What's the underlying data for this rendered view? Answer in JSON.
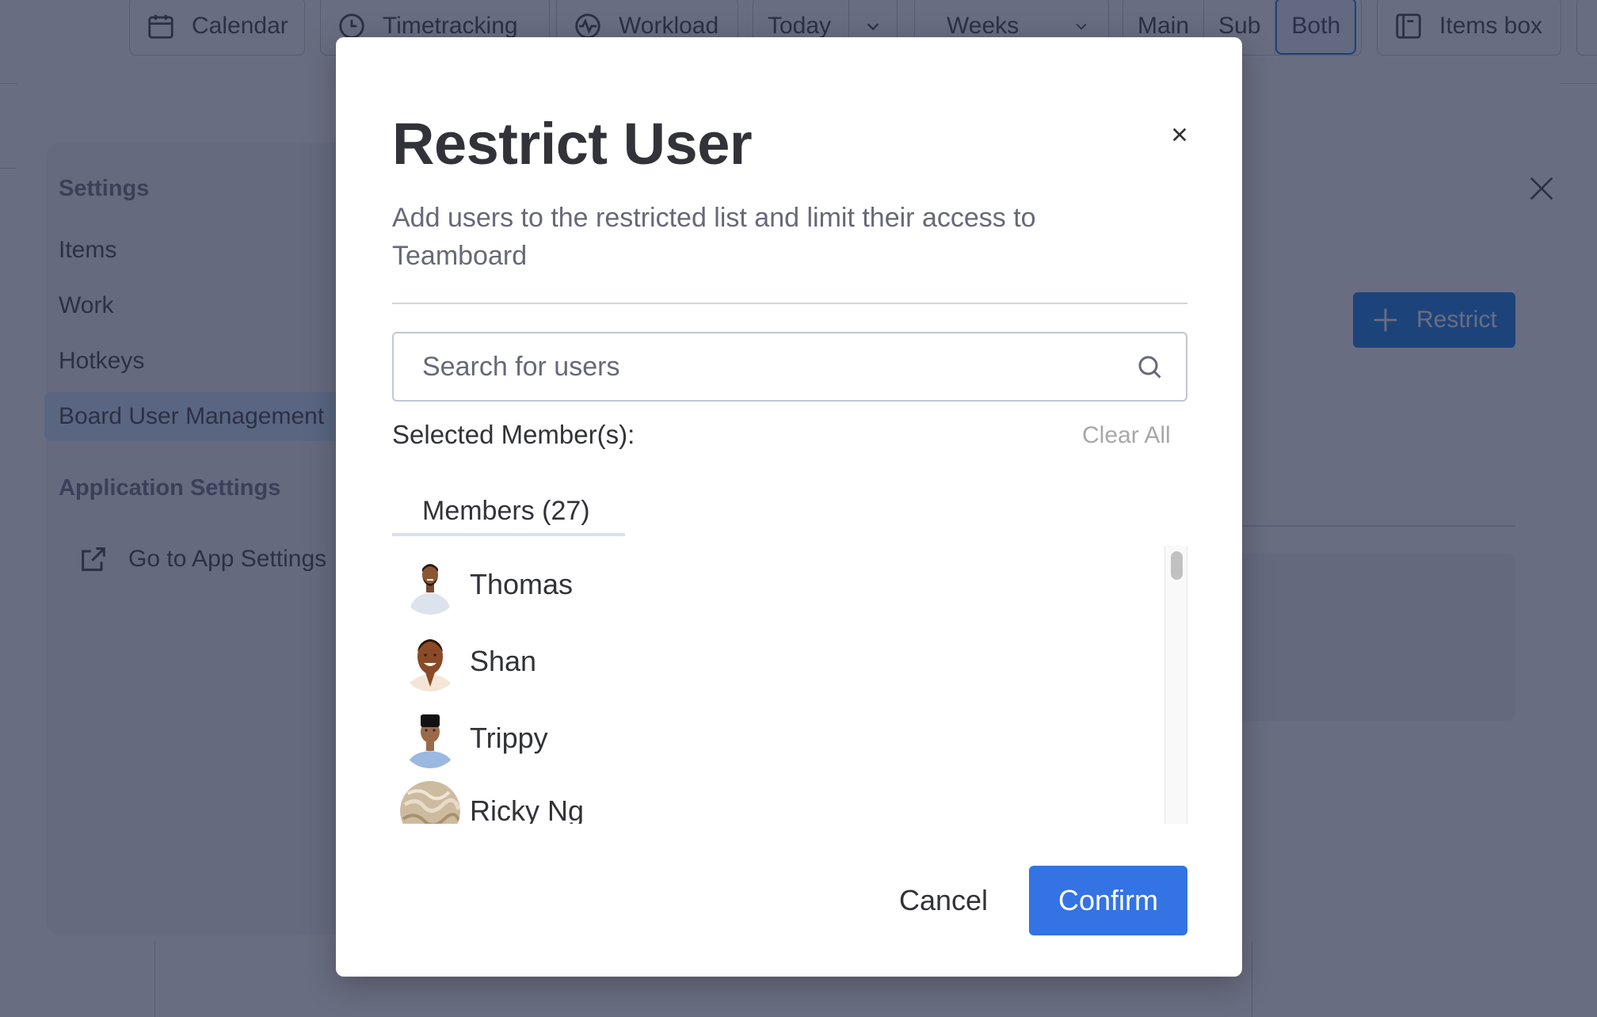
{
  "toolbar": {
    "calendar_label": "Calendar",
    "timetracking_label": "Timetracking",
    "workload_label": "Workload",
    "today_label": "Today",
    "weeks_label": "Weeks",
    "view_segments": [
      "Main",
      "Sub",
      "Both"
    ],
    "active_segment": "Both",
    "items_box_label": "Items box"
  },
  "settings_panel": {
    "settings_heading": "Settings",
    "nav_items": [
      {
        "label": "Items",
        "active": false
      },
      {
        "label": "Work",
        "active": false
      },
      {
        "label": "Hotkeys",
        "active": false
      },
      {
        "label": "Board User Management",
        "active": true
      }
    ],
    "app_settings_heading": "Application Settings",
    "go_to_app_settings_label": "Go to App Settings",
    "restrict_button_label": "Restrict"
  },
  "modal": {
    "title": "Restrict User",
    "description": "Add users to the restricted list and limit their access to Teamboard",
    "search": {
      "value": "",
      "placeholder": "Search for users"
    },
    "selected_members_label": "Selected Member(s):",
    "clear_all_label": "Clear All",
    "members_tab_label": "Members (27)",
    "members": [
      {
        "name": "Thomas",
        "avatar": "avatar-thomas"
      },
      {
        "name": "Shan",
        "avatar": "avatar-shan"
      },
      {
        "name": "Trippy",
        "avatar": "avatar-trippy"
      },
      {
        "name": "Ricky Ng",
        "avatar": "avatar-ricky-ng"
      }
    ],
    "cancel_label": "Cancel",
    "confirm_label": "Confirm"
  },
  "colors": {
    "primary": "#3373e4",
    "overlay": "#292f4c",
    "text": "#323338",
    "muted_text": "#676879"
  }
}
